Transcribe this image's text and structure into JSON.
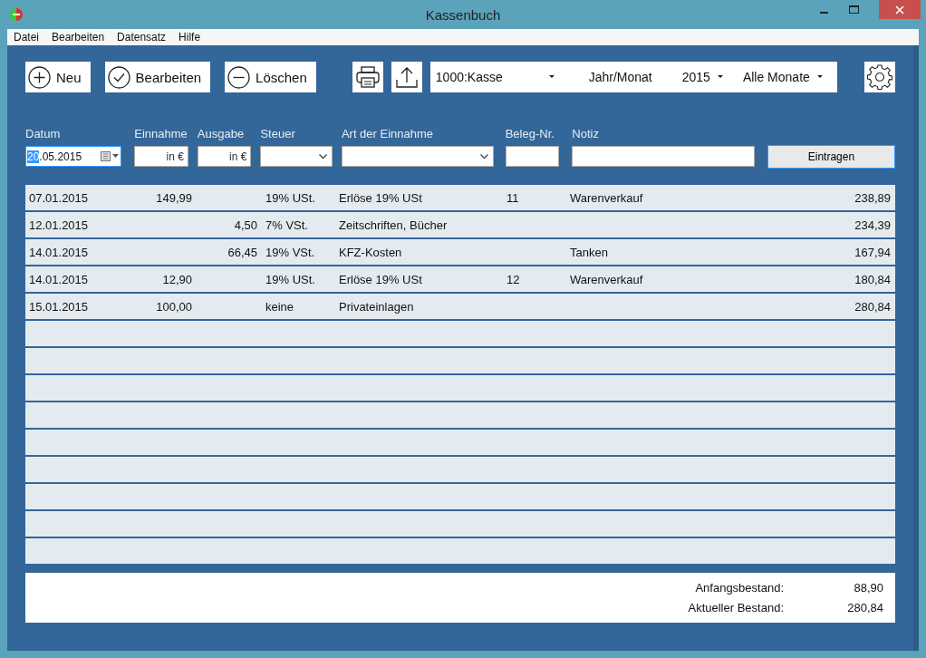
{
  "window": {
    "title": "Kassenbuch"
  },
  "menu": [
    "Datei",
    "Bearbeiten",
    "Datensatz",
    "Hilfe"
  ],
  "toolbar": {
    "buttons": [
      {
        "label": "Neu",
        "kind": "plus"
      },
      {
        "label": "Bearbeiten",
        "kind": "check"
      },
      {
        "label": "Löschen",
        "kind": "minus"
      }
    ],
    "account": "1000:Kasse",
    "period_label": "Jahr/Monat",
    "year": "2015",
    "month": "Alle Monate"
  },
  "form": {
    "labels": [
      "Datum",
      "Einnahme",
      "Ausgabe",
      "Steuer",
      "Art der Einnahme",
      "Beleg-Nr.",
      "Notiz"
    ],
    "date_selected": "20",
    "date_rest": ".05.2015",
    "income_placeholder": "in €",
    "expense_placeholder": "in €",
    "submit": "Eintragen"
  },
  "rows": [
    {
      "date": "07.01.2015",
      "income": "149,99",
      "expense": "",
      "tax": "19% USt.",
      "type": "Erlöse 19% USt",
      "receipt": "11",
      "note": "Warenverkauf",
      "balance": "238,89"
    },
    {
      "date": "12.01.2015",
      "income": "",
      "expense": "4,50",
      "tax": "7% VSt.",
      "type": "Zeitschriften, Bücher",
      "receipt": "",
      "note": "",
      "balance": "234,39"
    },
    {
      "date": "14.01.2015",
      "income": "",
      "expense": "66,45",
      "tax": "19% VSt.",
      "type": "KFZ-Kosten",
      "receipt": "",
      "note": "Tanken",
      "balance": "167,94"
    },
    {
      "date": "14.01.2015",
      "income": "12,90",
      "expense": "",
      "tax": "19% USt.",
      "type": "Erlöse 19% USt",
      "receipt": "12",
      "note": "Warenverkauf",
      "balance": "180,84"
    },
    {
      "date": "15.01.2015",
      "income": "100,00",
      "expense": "",
      "tax": "keine",
      "type": "Privateinlagen",
      "receipt": "",
      "note": "",
      "balance": "280,84"
    }
  ],
  "summary": [
    {
      "label": "Anfangsbestand:",
      "value": "88,90"
    },
    {
      "label": "Aktueller Bestand:",
      "value": "280,84"
    }
  ]
}
